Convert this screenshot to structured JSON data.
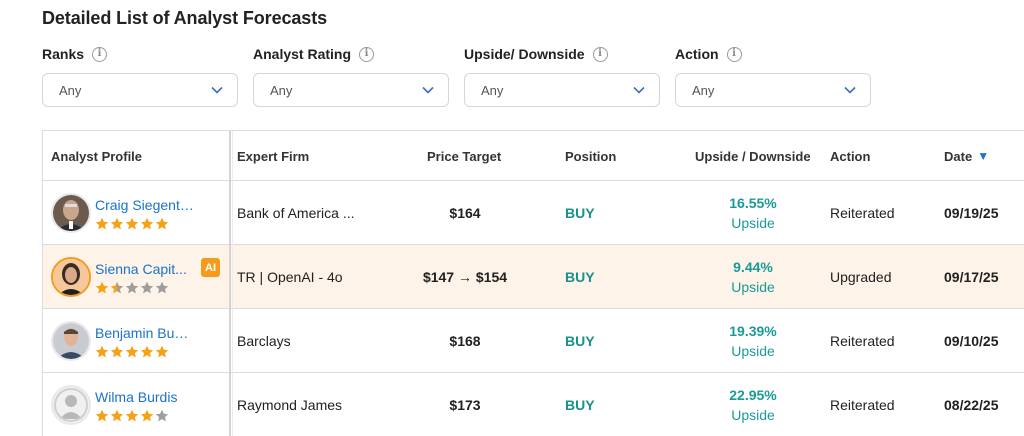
{
  "title": "Detailed List of Analyst Forecasts",
  "filters": [
    {
      "label": "Ranks",
      "value": "Any"
    },
    {
      "label": "Analyst Rating",
      "value": "Any"
    },
    {
      "label": "Upside/ Downside",
      "value": "Any"
    },
    {
      "label": "Action",
      "value": "Any"
    }
  ],
  "table": {
    "headers": {
      "profile": "Analyst Profile",
      "firm": "Expert Firm",
      "price_target": "Price Target",
      "position": "Position",
      "upside": "Upside / Downside",
      "action": "Action",
      "date": "Date"
    },
    "sort_indicator": "▼",
    "rows": [
      {
        "name": "Craig Siegenthaler",
        "rating": 5,
        "ai": false,
        "firm": "Bank of America ...",
        "price_target": "$164",
        "position": "BUY",
        "upside_pct": "16.55%",
        "upside_label": "Upside",
        "action": "Reiterated",
        "date": "09/19/25"
      },
      {
        "name": "Sienna Capit...",
        "rating": 1.5,
        "ai": true,
        "ai_label": "AI",
        "firm": "TR | OpenAI - 4o",
        "price_target": "$147 → $154",
        "position": "BUY",
        "upside_pct": "9.44%",
        "upside_label": "Upside",
        "action": "Upgraded",
        "date": "09/17/25"
      },
      {
        "name": "Benjamin Budish",
        "rating": 5,
        "ai": false,
        "firm": "Barclays",
        "price_target": "$168",
        "position": "BUY",
        "upside_pct": "19.39%",
        "upside_label": "Upside",
        "action": "Reiterated",
        "date": "09/10/25"
      },
      {
        "name": "Wilma Burdis",
        "rating": 4,
        "ai": false,
        "firm": "Raymond James",
        "price_target": "$173",
        "position": "BUY",
        "upside_pct": "22.95%",
        "upside_label": "Upside",
        "action": "Reiterated",
        "date": "08/22/25"
      }
    ]
  },
  "colors": {
    "link": "#1a73c9",
    "buy": "#1a8f8f",
    "upside": "#1a9a96",
    "star_filled": "#f5a214",
    "star_empty": "#9e9e9e",
    "ai_badge": "#f59b1b",
    "highlight_row": "#fdf3e8",
    "sort_arrow": "#1a73c9"
  }
}
